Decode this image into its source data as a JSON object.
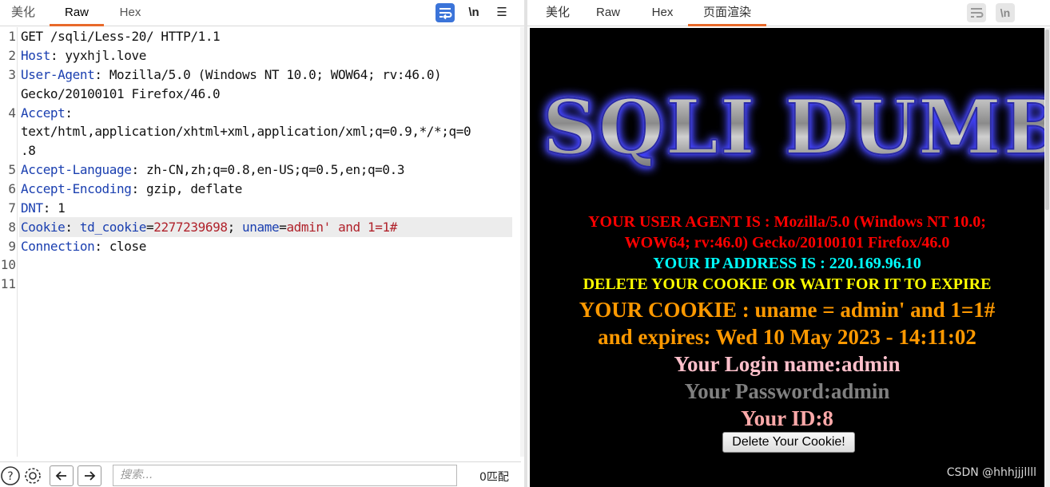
{
  "left_pane": {
    "tabs": [
      {
        "label": "美化"
      },
      {
        "label": "Raw"
      },
      {
        "label": "Hex"
      }
    ],
    "toolbar": {
      "newline_label": "\\n",
      "menu_label": "☰"
    },
    "request": {
      "line1": "GET /sqli/Less-20/ HTTP/1.1",
      "host_key": "Host",
      "host_val": "yyxhjl.love",
      "ua_key": "User-Agent",
      "ua_val": "Mozilla/5.0 (Windows NT 10.0; WOW64; rv:46.0)",
      "ua_val_cont": "Gecko/20100101 Firefox/46.0",
      "accept_key": "Accept",
      "accept_val": "text/html,application/xhtml+xml,application/xml;q=0.9,*/*;q=0",
      "accept_val_cont": ".8",
      "al_key": "Accept-Language",
      "al_val": "zh-CN,zh;q=0.8,en-US;q=0.5,en;q=0.3",
      "ae_key": "Accept-Encoding",
      "ae_val": "gzip, deflate",
      "dnt_key": "DNT",
      "dnt_val": "1",
      "cookie_key": "Cookie",
      "cookie_name1": "td_cookie",
      "cookie_val1": "2277239698",
      "cookie_name2": "uname",
      "cookie_val2": "admin' and 1=1#",
      "conn_key": "Connection",
      "conn_val": "close"
    },
    "line_numbers": [
      "1",
      "2",
      "3",
      "4",
      "5",
      "6",
      "7",
      "8",
      "9",
      "10",
      "11"
    ],
    "search": {
      "placeholder": "搜索..."
    },
    "match_count": "0匹配"
  },
  "right_pane": {
    "tabs": [
      {
        "label": "美化"
      },
      {
        "label": "Raw"
      },
      {
        "label": "Hex"
      },
      {
        "label": "页面渲染"
      }
    ],
    "toolbar": {
      "newline_label": "\\n"
    },
    "page": {
      "logo_text": "SQLI DUMB",
      "user_agent_line1": "YOUR USER AGENT IS : Mozilla/5.0 (Windows NT 10.0;",
      "user_agent_line2": "WOW64; rv:46.0) Gecko/20100101 Firefox/46.0",
      "ip_line": "YOUR IP ADDRESS IS : 220.169.96.10",
      "delete_notice": "DELETE YOUR COOKIE OR WAIT FOR IT TO EXPIRE",
      "cookie_line": "YOUR COOKIE : uname = admin' and 1=1#",
      "expires_line": "and expires: Wed 10 May 2023 - 14:11:02",
      "login_line": "Your Login name:admin",
      "password_line": "Your Password:admin",
      "id_line": "Your ID:8",
      "delete_button": "Delete Your Cookie!"
    },
    "watermark": "CSDN @hhhjjjllll"
  },
  "colors": {
    "accent_tab": "#e8692a",
    "header_key": "#1a3fb0",
    "cookie_value": "#b0222b",
    "render_bg": "#000000"
  }
}
